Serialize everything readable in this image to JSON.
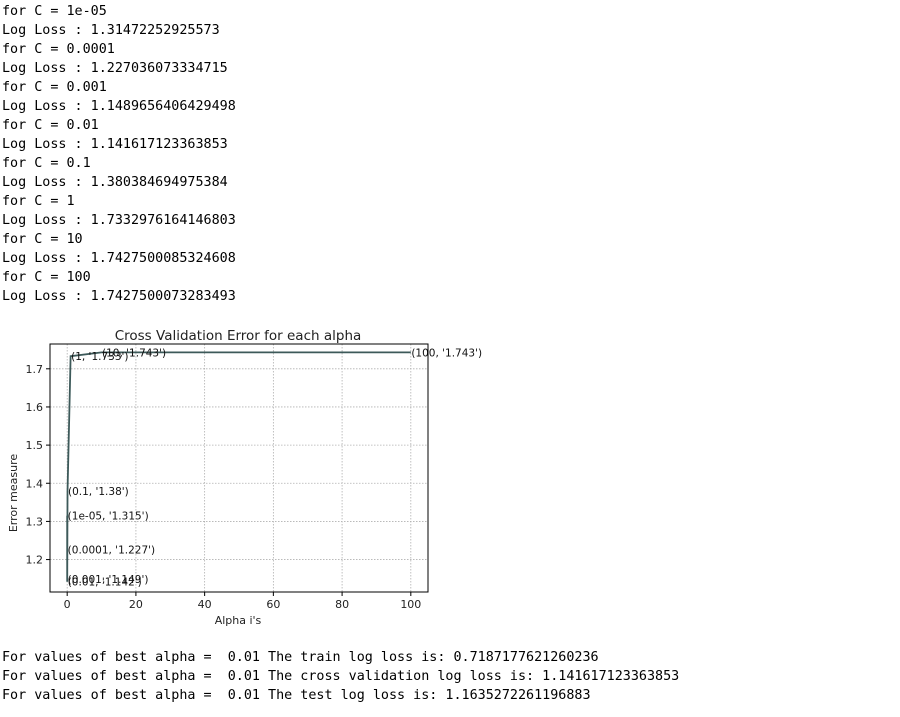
{
  "log_lines": [
    "for C = 1e-05",
    "Log Loss : 1.31472252925573",
    "for C = 0.0001",
    "Log Loss : 1.227036073334715",
    "for C = 0.001",
    "Log Loss : 1.1489656406429498",
    "for C = 0.01",
    "Log Loss : 1.141617123363853",
    "for C = 0.1",
    "Log Loss : 1.380384694975384",
    "for C = 1",
    "Log Loss : 1.7332976164146803",
    "for C = 10",
    "Log Loss : 1.7427500085324608",
    "for C = 100",
    "Log Loss : 1.7427500073283493"
  ],
  "result_lines": [
    "For values of best alpha =  0.01 The train log loss is: 0.7187177621260236",
    "For values of best alpha =  0.01 The cross validation log loss is: 1.141617123363853",
    "For values of best alpha =  0.01 The test log loss is: 1.1635272261196883"
  ],
  "chart_data": {
    "type": "line",
    "title": "Cross Validation Error for each alpha",
    "xlabel": "Alpha i's",
    "ylabel": "Error measure",
    "x": [
      1e-05,
      0.0001,
      0.001,
      0.01,
      0.1,
      1,
      10,
      100
    ],
    "y": [
      1.315,
      1.227,
      1.149,
      1.142,
      1.38,
      1.733,
      1.743,
      1.743
    ],
    "annotations": [
      "(1e-05, '1.315')",
      "(0.0001, '1.227')",
      "(0.001, '1.149')",
      "(0.01, '1.142')",
      "(0.1, '1.38')",
      "(1, '1.733')",
      "(10, '1.743')",
      "(100, '1.743')"
    ],
    "xlim": [
      -5,
      105
    ],
    "ylim": [
      1.115,
      1.765
    ],
    "xticks": [
      "0",
      "20",
      "40",
      "60",
      "80",
      "100"
    ],
    "xtick_values": [
      0,
      20,
      40,
      60,
      80,
      100
    ],
    "yticks": [
      "1.2",
      "1.3",
      "1.4",
      "1.5",
      "1.6",
      "1.7"
    ],
    "ytick_values": [
      1.2,
      1.3,
      1.4,
      1.5,
      1.6,
      1.7
    ],
    "grid": true,
    "line_color": "#3d5a5a"
  }
}
